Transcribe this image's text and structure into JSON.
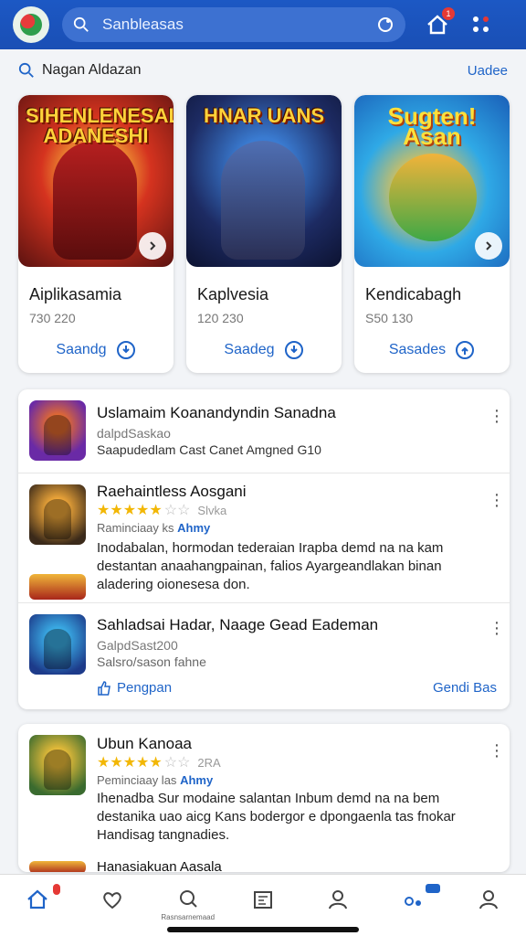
{
  "topbar": {
    "search_text": "Sanbleasas",
    "notification_count": "1",
    "icons": [
      "app-logo",
      "search-icon",
      "camera-icon",
      "home-icon",
      "apps-icon"
    ]
  },
  "section": {
    "title": "Nagan Aldazan",
    "more_label": "Uadee"
  },
  "featured": [
    {
      "art_title": "SIHENLENESAL ADANESHI",
      "name": "Aiplikasamia",
      "numbers": "730 220",
      "action": "Saandg"
    },
    {
      "art_title": "HNAR UANS",
      "name": "Kaplvesia",
      "numbers": "120 230",
      "action": "Saadeg"
    },
    {
      "art_title": "Sugten! Asan",
      "name": "Kendicabagh",
      "numbers": "S50 130",
      "action": "Sasades"
    }
  ],
  "list": {
    "item1": {
      "title": "Uslamaim Koanandyndin Sanadna",
      "sub": "dalpdSaskao",
      "line": "Saapudedlam Cast Canet Amgned G10"
    },
    "item2": {
      "title": "Raehaintless Aosgani",
      "rating_text": "Slvka",
      "meta_prefix": "Raminciaay ks",
      "meta_highlight": "Ahmy",
      "body": "Inodabalan, hormodan tederaian Irapba demd na na kam destantan anaahangpainan, falios Ayargeandlakan binan aladering oionesesa don."
    },
    "item3": {
      "title": "Sahladsai Hadar, Naage Gead Eademan",
      "sub": "GalpdSast200",
      "line": "Salsro/sason fahne",
      "foot_left": "Pengpan",
      "foot_right": "Gendi Bas"
    }
  },
  "list2": {
    "item1": {
      "title": "Ubun Kanoaa",
      "rating_text": "2RA",
      "meta_prefix": "Peminciaay las",
      "meta_highlight": "Ahmy",
      "body": "Ihenadba Sur modaine salantan Inbum demd na na bem destanika uao aicg Kans bodergor e dpongaenla tas fnokar Handisag tangnadies."
    },
    "item2": {
      "title": "Hanasiakuan Aasala"
    }
  },
  "bottom_nav": {
    "items": [
      "home-icon",
      "heart-icon",
      "search-icon",
      "catalog-icon",
      "profile-icon",
      "notifications-icon",
      "account-icon"
    ],
    "search_label": "Rasnsarnemaad"
  }
}
